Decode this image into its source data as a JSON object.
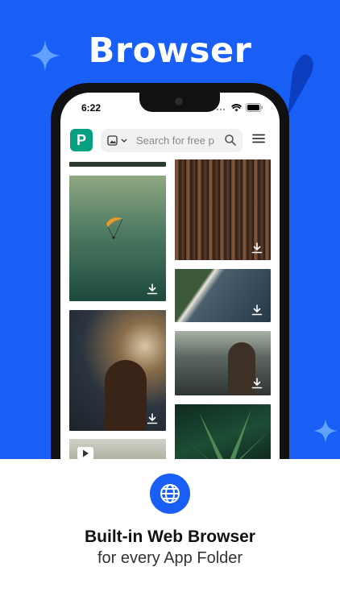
{
  "hero": {
    "title": "Browser"
  },
  "status_bar": {
    "time": "6:22"
  },
  "browser": {
    "search_placeholder": "Search for free p"
  },
  "caption": {
    "title": "Built-in Web Browser",
    "subtitle": "for every App Folder"
  },
  "colors": {
    "brand_blue": "#1a5ff5",
    "logo_green": "#05a081"
  }
}
